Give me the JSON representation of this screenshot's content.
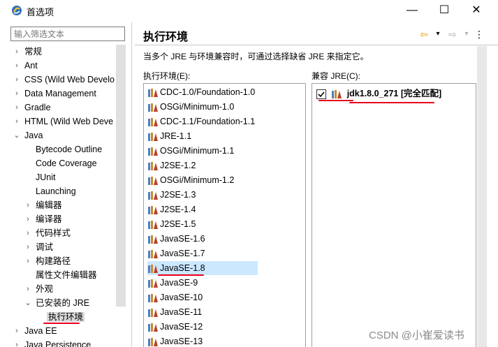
{
  "window": {
    "title": "首选项",
    "controls": {
      "minimize": "—",
      "maximize": "☐",
      "close": "✕"
    }
  },
  "filter": {
    "placeholder": "输入筛选文本"
  },
  "tree": [
    {
      "label": "常规",
      "level": 0,
      "chevron": "›"
    },
    {
      "label": "Ant",
      "level": 0,
      "chevron": "›"
    },
    {
      "label": "CSS (Wild Web Develo",
      "level": 0,
      "chevron": "›"
    },
    {
      "label": "Data Management",
      "level": 0,
      "chevron": "›"
    },
    {
      "label": "Gradle",
      "level": 0,
      "chevron": "›"
    },
    {
      "label": "HTML (Wild Web Deve",
      "level": 0,
      "chevron": "›"
    },
    {
      "label": "Java",
      "level": 0,
      "chevron": "⌄"
    },
    {
      "label": "Bytecode Outline",
      "level": 1,
      "chevron": ""
    },
    {
      "label": "Code Coverage",
      "level": 1,
      "chevron": ""
    },
    {
      "label": "JUnit",
      "level": 1,
      "chevron": ""
    },
    {
      "label": "Launching",
      "level": 1,
      "chevron": ""
    },
    {
      "label": "编辑器",
      "level": 1,
      "chevron": "›"
    },
    {
      "label": "编译器",
      "level": 1,
      "chevron": "›"
    },
    {
      "label": "代码样式",
      "level": 1,
      "chevron": "›"
    },
    {
      "label": "调试",
      "level": 1,
      "chevron": "›"
    },
    {
      "label": "构建路径",
      "level": 1,
      "chevron": "›"
    },
    {
      "label": "属性文件编辑器",
      "level": 1,
      "chevron": ""
    },
    {
      "label": "外观",
      "level": 1,
      "chevron": "›"
    },
    {
      "label": "已安装的 JRE",
      "level": 1,
      "chevron": "⌄"
    },
    {
      "label": "执行环境",
      "level": 2,
      "chevron": "",
      "selected": true
    },
    {
      "label": "Java EE",
      "level": 0,
      "chevron": "›"
    },
    {
      "label": "Java Persistence",
      "level": 0,
      "chevron": "›"
    }
  ],
  "page": {
    "title": "执行环境",
    "description": "当多个 JRE 与环境兼容时，可通过选择缺省 JRE 来指定它。",
    "env_label": "执行环境(E):",
    "jre_label": "兼容 JRE(C):",
    "nav": {
      "back": "⇦",
      "back_menu": "▾",
      "forward": "⇨",
      "forward_menu": "▾",
      "more": "⋮"
    }
  },
  "environments": [
    "CDC-1.0/Foundation-1.0",
    "OSGi/Minimum-1.0",
    "CDC-1.1/Foundation-1.1",
    "JRE-1.1",
    "OSGi/Minimum-1.1",
    "J2SE-1.2",
    "OSGi/Minimum-1.2",
    "J2SE-1.3",
    "J2SE-1.4",
    "J2SE-1.5",
    "JavaSE-1.6",
    "JavaSE-1.7",
    "JavaSE-1.8",
    "JavaSE-9",
    "JavaSE-10",
    "JavaSE-11",
    "JavaSE-12",
    "JavaSE-13"
  ],
  "selected_environment": "JavaSE-1.8",
  "compatible_jres": [
    {
      "label": "jdk1.8.0_271 [完全匹配]",
      "checked": true
    }
  ],
  "watermark": "CSDN @小崔爱读书",
  "colors": {
    "selection": "#cce8ff",
    "annotation_red": "#e8001c"
  }
}
